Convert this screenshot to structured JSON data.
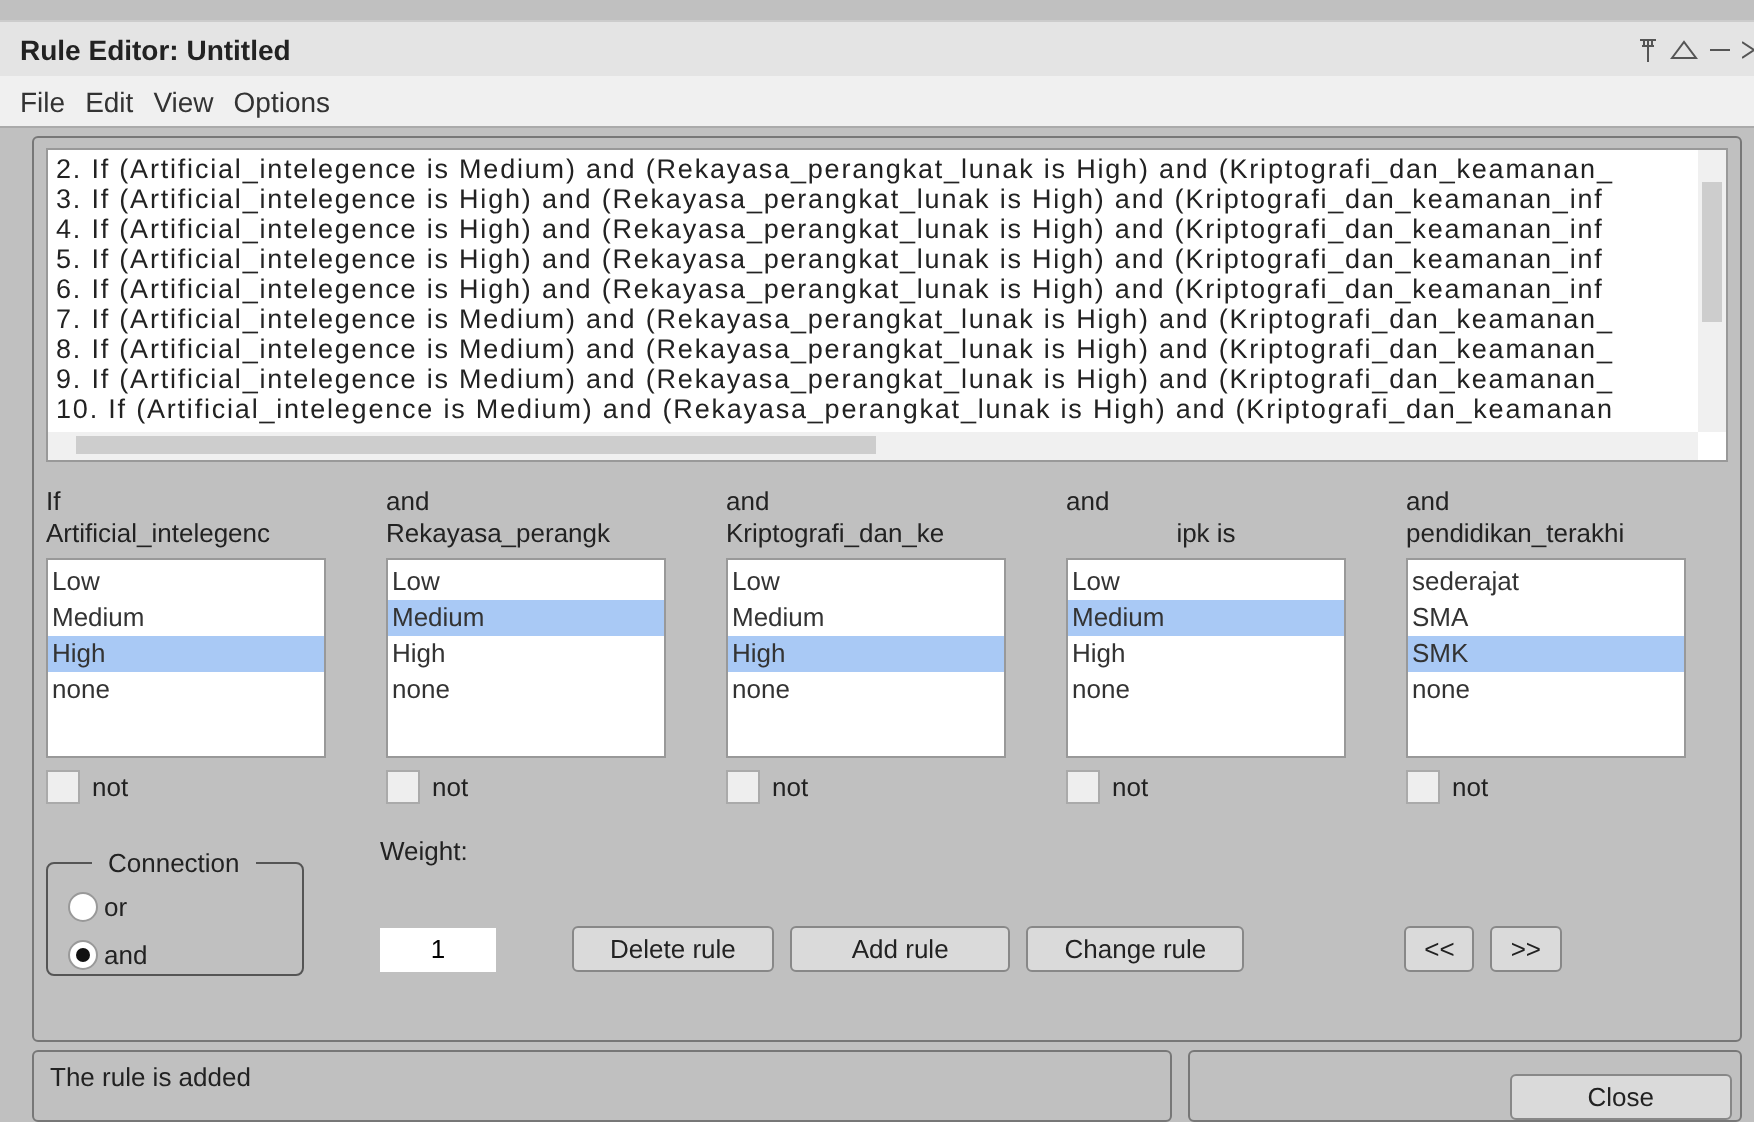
{
  "window": {
    "title": "Rule Editor: Untitled"
  },
  "menu": [
    "File",
    "Edit",
    "View",
    "Options"
  ],
  "rules": [
    "2. If (Artificial_intelegence is Medium) and (Rekayasa_perangkat_lunak is High) and (Kriptografi_dan_keamanan_",
    "3. If (Artificial_intelegence is High) and (Rekayasa_perangkat_lunak is High) and (Kriptografi_dan_keamanan_inf",
    "4. If (Artificial_intelegence is High) and (Rekayasa_perangkat_lunak is High) and (Kriptografi_dan_keamanan_inf",
    "5. If (Artificial_intelegence is High) and (Rekayasa_perangkat_lunak is High) and (Kriptografi_dan_keamanan_inf",
    "6. If (Artificial_intelegence is High) and (Rekayasa_perangkat_lunak is High) and (Kriptografi_dan_keamanan_inf",
    "7. If (Artificial_intelegence is Medium) and (Rekayasa_perangkat_lunak is High) and (Kriptografi_dan_keamanan_",
    "8. If (Artificial_intelegence is Medium) and (Rekayasa_perangkat_lunak is High) and (Kriptografi_dan_keamanan_",
    "9. If (Artificial_intelegence is Medium) and (Rekayasa_perangkat_lunak is High) and (Kriptografi_dan_keamanan_",
    "10. If (Artificial_intelegence is Medium) and (Rekayasa_perangkat_lunak is High) and (Kriptografi_dan_keamanan"
  ],
  "inputs": [
    {
      "connector": "If",
      "variable": "Artificial_intelegenc",
      "centered": false,
      "not": false,
      "options": [
        {
          "label": "Low",
          "selected": false
        },
        {
          "label": "Medium",
          "selected": false
        },
        {
          "label": "High",
          "selected": true
        },
        {
          "label": "none",
          "selected": false
        }
      ],
      "not_label": "not"
    },
    {
      "connector": "and",
      "variable": "Rekayasa_perangk",
      "centered": false,
      "not": false,
      "options": [
        {
          "label": "Low",
          "selected": false
        },
        {
          "label": "Medium",
          "selected": true
        },
        {
          "label": "High",
          "selected": false
        },
        {
          "label": "none",
          "selected": false
        }
      ],
      "not_label": "not"
    },
    {
      "connector": "and",
      "variable": "Kriptografi_dan_ke",
      "centered": false,
      "not": false,
      "options": [
        {
          "label": "Low",
          "selected": false
        },
        {
          "label": "Medium",
          "selected": false
        },
        {
          "label": "High",
          "selected": true
        },
        {
          "label": "none",
          "selected": false
        }
      ],
      "not_label": "not"
    },
    {
      "connector": "and",
      "variable": "ipk is",
      "centered": true,
      "not": false,
      "options": [
        {
          "label": "Low",
          "selected": false
        },
        {
          "label": "Medium",
          "selected": true
        },
        {
          "label": "High",
          "selected": false
        },
        {
          "label": "none",
          "selected": false
        }
      ],
      "not_label": "not"
    },
    {
      "connector": "and",
      "variable": "pendidikan_terakhi",
      "centered": false,
      "not": false,
      "options": [
        {
          "label": "sederajat",
          "selected": false
        },
        {
          "label": "SMA",
          "selected": false
        },
        {
          "label": "SMK",
          "selected": true
        },
        {
          "label": "none",
          "selected": false
        }
      ],
      "not_label": "not"
    }
  ],
  "connection": {
    "label": "Connection",
    "options": [
      {
        "label": "or",
        "selected": false
      },
      {
        "label": "and",
        "selected": true
      }
    ]
  },
  "weight": {
    "label": "Weight:",
    "value": "1"
  },
  "buttons": [
    "Delete rule",
    "Add rule",
    "Change rule"
  ],
  "nav": [
    "<<",
    ">>"
  ],
  "status": "The rule is added",
  "close": "Close"
}
